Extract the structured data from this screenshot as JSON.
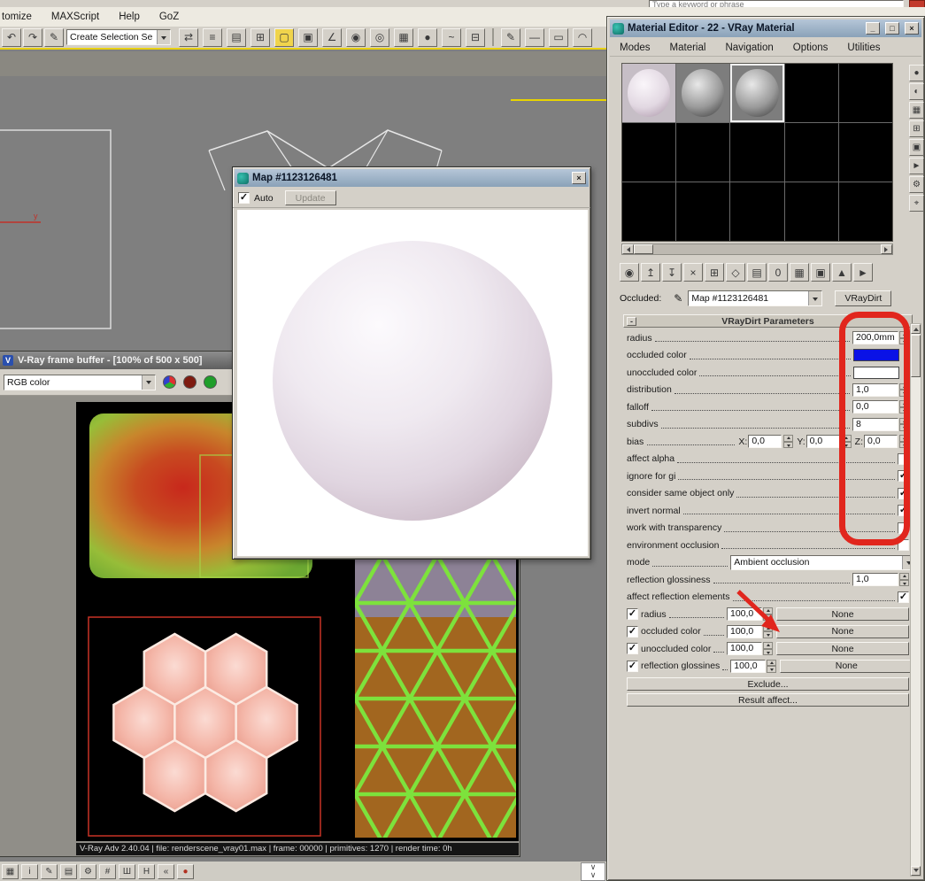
{
  "chrome": {
    "menus": [
      "tomize",
      "MAXScript",
      "Help",
      "GoZ"
    ],
    "search_placeholder": "Type a keyword or phrase",
    "selection_combo": "Create Selection Se"
  },
  "viewport": {
    "axis_label": "y"
  },
  "framebuffer": {
    "title": "V-Ray frame buffer - [100% of 500 x 500]",
    "channel": "RGB color",
    "status": "V-Ray Adv 2.40.04 | file: renderscene_vray01.max | frame: 00000 | primitives: 1270 | render time: 0h",
    "colors": {
      "red": "#7e1b10",
      "green": "#1f9e2a"
    }
  },
  "map_window": {
    "title": "Map #1123126481",
    "auto_label": "Auto",
    "auto_checked": true,
    "update_label": "Update"
  },
  "meditor": {
    "title": "Material Editor - 22 - VRay Material",
    "menus": [
      "Modes",
      "Material",
      "Navigation",
      "Options",
      "Utilities"
    ],
    "occluded_label": "Occluded:",
    "map_name": "Map #1123126481",
    "class_button": "VRayDirt",
    "rollout": "VRayDirt Parameters",
    "rows": [
      {
        "label": "radius",
        "value": "200,0mm"
      },
      {
        "label": "occluded color",
        "color": "#0a12e6"
      },
      {
        "label": "unoccluded color",
        "color": "#ffffff"
      },
      {
        "label": "distribution",
        "value": "1,0"
      },
      {
        "label": "falloff",
        "value": "0,0"
      },
      {
        "label": "subdivs",
        "value": "8"
      },
      {
        "label": "bias",
        "x_label": "X:",
        "x": "0,0",
        "y_label": "Y:",
        "y": "0,0",
        "z_label": "Z:",
        "z": "0,0"
      },
      {
        "label": "affect alpha",
        "checked": false
      },
      {
        "label": "ignore for gi",
        "checked": true
      },
      {
        "label": "consider same object only",
        "checked": true
      },
      {
        "label": "invert normal",
        "checked": true
      },
      {
        "label": "work with transparency",
        "checked": false
      },
      {
        "label": "environment occlusion",
        "checked": false
      },
      {
        "label": "mode",
        "value": "Ambient occlusion"
      },
      {
        "label": "reflection glossiness",
        "value": "1,0"
      },
      {
        "label": "affect reflection elements",
        "checked": true
      }
    ],
    "map_rows": [
      {
        "label": "radius",
        "amount": "100,0",
        "button": "None",
        "checked": true
      },
      {
        "label": "occluded color",
        "amount": "100,0",
        "button": "None",
        "checked": true
      },
      {
        "label": "unoccluded color",
        "amount": "100,0",
        "button": "None",
        "checked": true
      },
      {
        "label": "reflection glossines",
        "amount": "100,0",
        "button": "None",
        "checked": true
      }
    ],
    "exclude": "Exclude...",
    "result_affect": "Result affect..."
  },
  "glyphs": {
    "min": "_",
    "max": "□",
    "close": "×",
    "minus": "-",
    "chevron": "∨"
  },
  "annotation": {
    "color": "#e1261d"
  },
  "icons": {
    "toolbar_left": [
      {
        "name": "undo-icon",
        "g": "↶"
      },
      {
        "name": "redo-icon",
        "g": "↷"
      },
      {
        "name": "named-selection-icon",
        "g": "✎"
      }
    ],
    "toolbar_main": [
      {
        "name": "mirror-icon",
        "g": "⇄"
      },
      {
        "name": "align-icon",
        "g": "≡"
      },
      {
        "name": "layer-manager-icon",
        "g": "▤"
      },
      {
        "name": "scene-explorer-icon",
        "g": "⊞"
      },
      {
        "name": "region-select-icon",
        "g": "▢",
        "active": true
      },
      {
        "name": "crossing-select-icon",
        "g": "▣"
      },
      {
        "name": "snap-toggle-icon",
        "g": "∠"
      },
      {
        "name": "material-editor-icon",
        "g": "◉"
      },
      {
        "name": "render-setup-icon",
        "g": "◎"
      },
      {
        "name": "rendered-frame-icon",
        "g": "▦"
      },
      {
        "name": "render-icon",
        "g": "●"
      },
      {
        "name": "curve-editor-icon",
        "g": "~"
      },
      {
        "name": "schematic-view-icon",
        "g": "⊟"
      }
    ],
    "toolbar_right": [
      {
        "name": "pencil-icon",
        "g": "✎"
      },
      {
        "name": "dash-icon",
        "g": "—"
      },
      {
        "name": "rectangle-tool-icon",
        "g": "▭"
      },
      {
        "name": "arc-tool-icon",
        "g": "◠"
      }
    ],
    "meditor_toolbar": [
      {
        "name": "get-material-icon",
        "g": "◉"
      },
      {
        "name": "put-material-icon",
        "g": "↥"
      },
      {
        "name": "assign-material-icon",
        "g": "↧"
      },
      {
        "name": "reset-map-icon",
        "g": "×"
      },
      {
        "name": "make-copy-icon",
        "g": "⊞"
      },
      {
        "name": "make-unique-icon",
        "g": "◇"
      },
      {
        "name": "put-library-icon",
        "g": "▤"
      },
      {
        "name": "material-id-icon",
        "g": "0"
      },
      {
        "name": "show-map-icon",
        "g": "▦"
      },
      {
        "name": "show-end-result-icon",
        "g": "▣"
      },
      {
        "name": "go-parent-icon",
        "g": "▲"
      },
      {
        "name": "go-sibling-icon",
        "g": "►"
      }
    ],
    "meditor_side": [
      {
        "name": "sample-type-icon",
        "g": "●"
      },
      {
        "name": "backlight-icon",
        "g": "◐"
      },
      {
        "name": "background-icon",
        "g": "▦"
      },
      {
        "name": "uv-tiling-icon",
        "g": "⊞"
      },
      {
        "name": "video-check-icon",
        "g": "▣"
      },
      {
        "name": "preview-icon",
        "g": "►"
      },
      {
        "name": "options-icon",
        "g": "⚙"
      },
      {
        "name": "select-by-material-icon",
        "g": "⌖"
      }
    ],
    "statusbar": [
      {
        "name": "grid-icon",
        "g": "▦"
      },
      {
        "name": "info-icon",
        "g": "i"
      },
      {
        "name": "pencil-icon",
        "g": "✎"
      },
      {
        "name": "layers-icon",
        "g": "▤"
      },
      {
        "name": "gear-icon",
        "g": "⚙"
      },
      {
        "name": "hash-icon",
        "g": "#"
      },
      {
        "name": "sha-icon",
        "g": "Ш"
      },
      {
        "name": "h-icon",
        "g": "H"
      },
      {
        "name": "rewind-icon",
        "g": "«"
      },
      {
        "name": "record-icon",
        "g": "●",
        "color": "#b23020"
      }
    ]
  }
}
